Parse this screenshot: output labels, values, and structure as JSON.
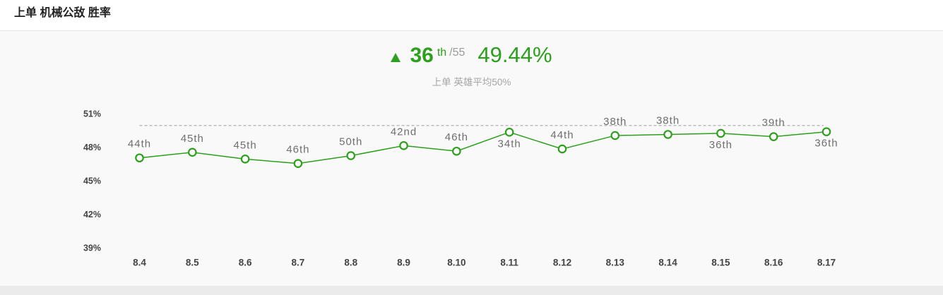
{
  "colors": {
    "accent": "#2ca01c",
    "reference_line": "#9a9a9a",
    "axis_text": "#444444",
    "point_label": "#6f6f6f",
    "muted": "#a6a6a6"
  },
  "summary": {
    "trend_icon": "triangle-up-icon",
    "rank": "36",
    "rank_suffix": "th",
    "rank_total": "/55",
    "win_rate": "49.44%",
    "subtitle": "上单 英雄平均50%"
  },
  "chart_data": {
    "type": "line",
    "title": "上单 机械公敌 胜率",
    "categories": [
      "8.4",
      "8.5",
      "8.6",
      "8.7",
      "8.8",
      "8.9",
      "8.10",
      "8.11",
      "8.12",
      "8.13",
      "8.14",
      "8.15",
      "8.16",
      "8.17"
    ],
    "series": [
      {
        "values": [
          47.1,
          47.6,
          47.0,
          46.6,
          47.3,
          48.2,
          47.7,
          49.4,
          47.9,
          49.1,
          49.2,
          49.3,
          49.0,
          49.44
        ],
        "point_labels": [
          "44th",
          "45th",
          "45th",
          "46th",
          "50th",
          "42nd",
          "46th",
          "34th",
          "44th",
          "38th",
          "38th",
          "36th",
          "39th",
          "36th"
        ]
      }
    ],
    "ylim": [
      39,
      51
    ],
    "yticks": [
      51,
      48,
      45,
      42,
      39
    ],
    "ytick_labels": [
      "51%",
      "48%",
      "45%",
      "42%",
      "39%"
    ],
    "reference_line": {
      "value": 50,
      "dashed": true
    },
    "grid": false
  }
}
